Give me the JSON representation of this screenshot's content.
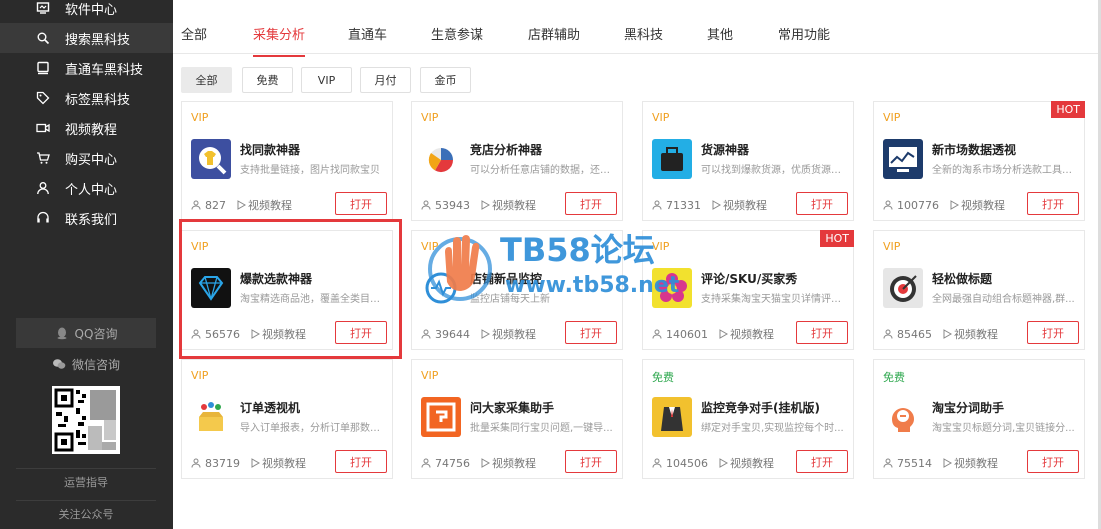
{
  "sidebar": {
    "items": [
      {
        "label": "软件中心",
        "icon": "software-icon"
      },
      {
        "label": "搜索黑科技",
        "icon": "search-icon"
      },
      {
        "label": "直通车黑科技",
        "icon": "car-icon"
      },
      {
        "label": "标签黑科技",
        "icon": "tag-icon"
      },
      {
        "label": "视频教程",
        "icon": "video-icon"
      },
      {
        "label": "购买中心",
        "icon": "cart-icon"
      },
      {
        "label": "个人中心",
        "icon": "user-icon"
      },
      {
        "label": "联系我们",
        "icon": "headset-icon"
      }
    ],
    "qq_consult": "QQ咨询",
    "wechat_consult": "微信咨询",
    "ops_guide": "运营指导",
    "follow_account": "关注公众号"
  },
  "tabs": [
    "全部",
    "采集分析",
    "直通车",
    "生意参谋",
    "店群辅助",
    "黑科技",
    "其他",
    "常用功能"
  ],
  "active_tab": "采集分析",
  "filters": [
    "全部",
    "免费",
    "VIP",
    "月付",
    "金币"
  ],
  "video_label": "视频教程",
  "open_label": "打开",
  "hot_label": "HOT",
  "cards": [
    {
      "badge": "VIP",
      "title": "找同款神器",
      "desc": "支持批量链接，图片找同款宝贝",
      "count": "827",
      "hot": false,
      "icon": "tshirt-search-icon"
    },
    {
      "badge": "VIP",
      "title": "竞店分析神器",
      "desc": "可以分析任意店铺的数据，还可...",
      "count": "53943",
      "hot": false,
      "icon": "pie-chart-icon"
    },
    {
      "badge": "VIP",
      "title": "货源神器",
      "desc": "可以找到爆款货源，优质货源，...",
      "count": "71331",
      "hot": false,
      "icon": "bag-icon"
    },
    {
      "badge": "VIP",
      "title": "新市场数据透视",
      "desc": "全新的淘系市场分析选款工具，...",
      "count": "100776",
      "hot": true,
      "icon": "line-chart-icon"
    },
    {
      "badge": "VIP",
      "title": "爆款选款神器",
      "desc": "淘宝精选商品池，覆盖全类目，...",
      "count": "56576",
      "hot": false,
      "icon": "diamond-icon"
    },
    {
      "badge": "VIP",
      "title": "店铺新品监控",
      "desc": "监控店铺每天上新",
      "count": "39644",
      "hot": false,
      "icon": "monitor-icon"
    },
    {
      "badge": "VIP",
      "title": "评论/SKU/买家秀",
      "desc": "支持采集淘宝天猫宝贝详情评论...",
      "count": "140601",
      "hot": true,
      "icon": "flower-icon"
    },
    {
      "badge": "VIP",
      "title": "轻松做标题",
      "desc": "全网最强自动组合标题神器,群...",
      "count": "85465",
      "hot": false,
      "icon": "target-icon"
    },
    {
      "badge": "VIP",
      "title": "订单透视机",
      "desc": "导入订单报表，分析订单那数据...",
      "count": "83719",
      "hot": false,
      "icon": "box-icon"
    },
    {
      "badge": "VIP",
      "title": "问大家采集助手",
      "desc": "批量采集同行宝贝问题,一键导...",
      "count": "74756",
      "hot": false,
      "icon": "question-icon"
    },
    {
      "badge": "免费",
      "title": "监控竞争对手(挂机版)",
      "desc": "绑定对手宝贝,实现监控每个时...",
      "count": "104506",
      "hot": false,
      "icon": "suit-icon"
    },
    {
      "badge": "免费",
      "title": "淘宝分词助手",
      "desc": "淘宝宝贝标题分词,宝贝链接分...",
      "count": "75514",
      "hot": false,
      "icon": "head-icon"
    }
  ],
  "watermark": {
    "line1": "TB58论坛",
    "line2": "www.tb58.net"
  }
}
